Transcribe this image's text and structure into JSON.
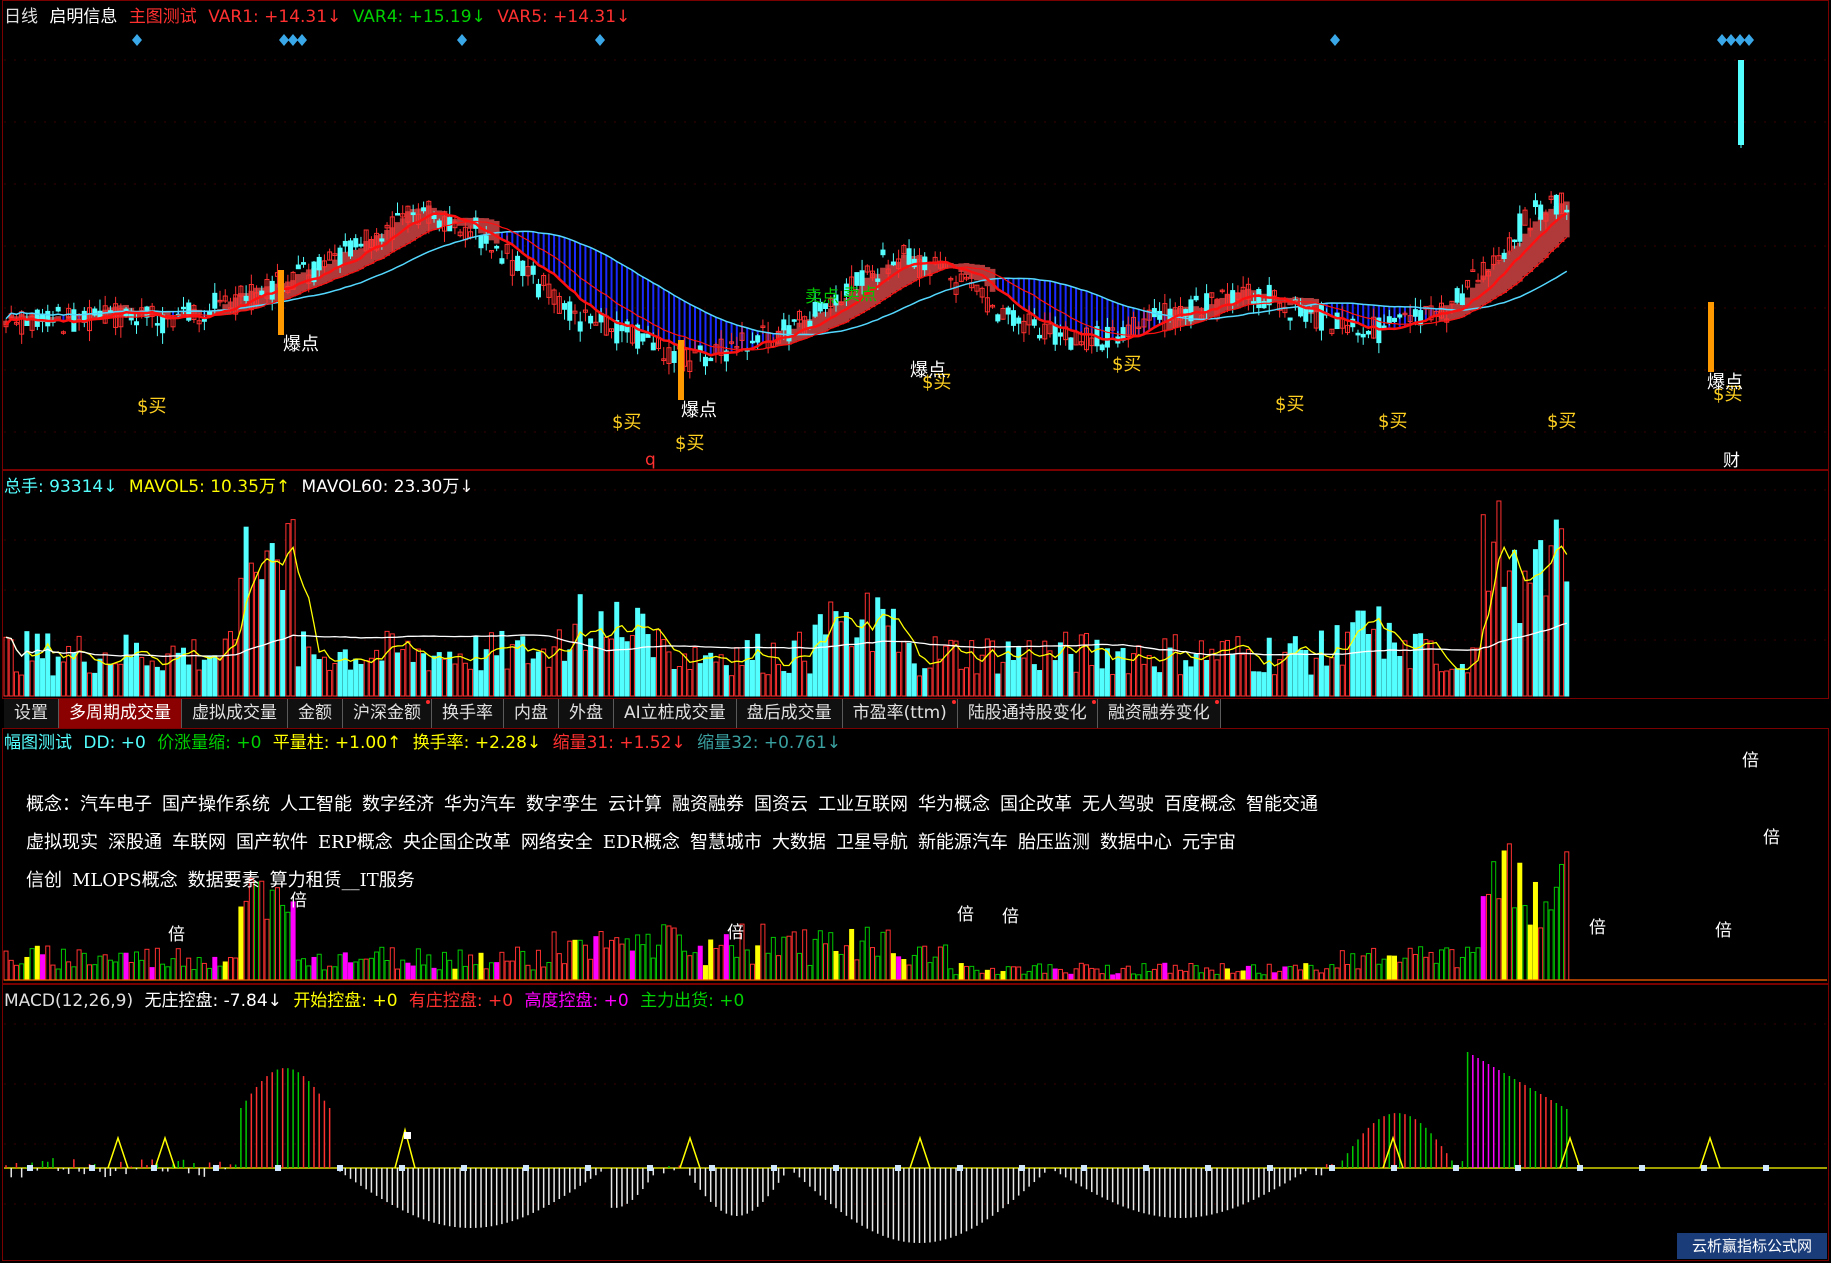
{
  "main_header": {
    "period": "日线",
    "stock": "启明信息",
    "indicator": "主图测试",
    "var1": "VAR1: +14.31↓",
    "var4": "VAR4: +15.19↓",
    "var5": "VAR5: +14.31↓"
  },
  "volume_header": {
    "total": "总手: 93314↓",
    "mavol5": "MAVOL5: 10.35万↑",
    "mavol60": "MAVOL60: 23.30万↓"
  },
  "tabs": [
    {
      "label": "设置",
      "dot": false
    },
    {
      "label": "多周期成交量",
      "dot": false,
      "active": true
    },
    {
      "label": "虚拟成交量",
      "dot": false
    },
    {
      "label": "金额",
      "dot": false
    },
    {
      "label": "沪深金额",
      "dot": true
    },
    {
      "label": "换手率",
      "dot": false
    },
    {
      "label": "内盘",
      "dot": false
    },
    {
      "label": "外盘",
      "dot": false
    },
    {
      "label": "AI立桩成交量",
      "dot": false
    },
    {
      "label": "盘后成交量",
      "dot": false
    },
    {
      "label": "市盈率(ttm)",
      "dot": true
    },
    {
      "label": "陆股通持股变化",
      "dot": true
    },
    {
      "label": "融资融券变化",
      "dot": true
    }
  ],
  "amp_header": {
    "title": "幅图测试",
    "dd": "DD: +0",
    "jzls": "价涨量缩: +0",
    "pll": "平量柱: +1.00↑",
    "hsl": "换手率: +2.28↓",
    "sl31": "缩量31: +1.52↓",
    "sl32": "缩量32: +0.761↓"
  },
  "concepts": {
    "row1": [
      "概念：汽车电子",
      "国产操作系统",
      "人工智能",
      "数字经济",
      "华为汽车",
      "数字孪生",
      "云计算",
      "融资融券",
      "国资云",
      "工业互联网",
      "华为概念",
      "国企改革",
      "无人驾驶",
      "百度概念",
      "智能交通"
    ],
    "row2": [
      "虚拟现实",
      "深股通",
      "车联网",
      "国产软件",
      "ERP概念",
      "央企国企改革",
      "网络安全",
      "EDR概念",
      "智慧城市",
      "大数据",
      "卫星导航",
      "新能源汽车",
      "胎压监测",
      "数据中心",
      "元宇宙"
    ],
    "row3": [
      "信创",
      "MLOPS概念",
      "数据要素",
      "算力租赁__IT服务"
    ]
  },
  "macd_header": {
    "name": "MACD(12,26,9)",
    "wzkp": "无庄控盘: -7.84↓",
    "kskp": "开始控盘: +0",
    "yzkp": "有庄控盘: +0",
    "gdkp": "高度控盘: +0",
    "zlch": "主力出货: +0"
  },
  "chart_labels": {
    "buy": "$买",
    "burst": "爆点",
    "sell": "卖点",
    "bei": "倍",
    "q": "q",
    "cai": "财"
  },
  "colors": {
    "up": "#ff3030",
    "down": "#54ffff",
    "ribbon": "#b03a3a",
    "blue_fill": "#1a2aff",
    "ma_red": "#ff1010",
    "yellow": "#ffff00",
    "magenta": "#ff00ff",
    "green": "#00c800"
  },
  "watermark": "云析赢指标公式网"
}
